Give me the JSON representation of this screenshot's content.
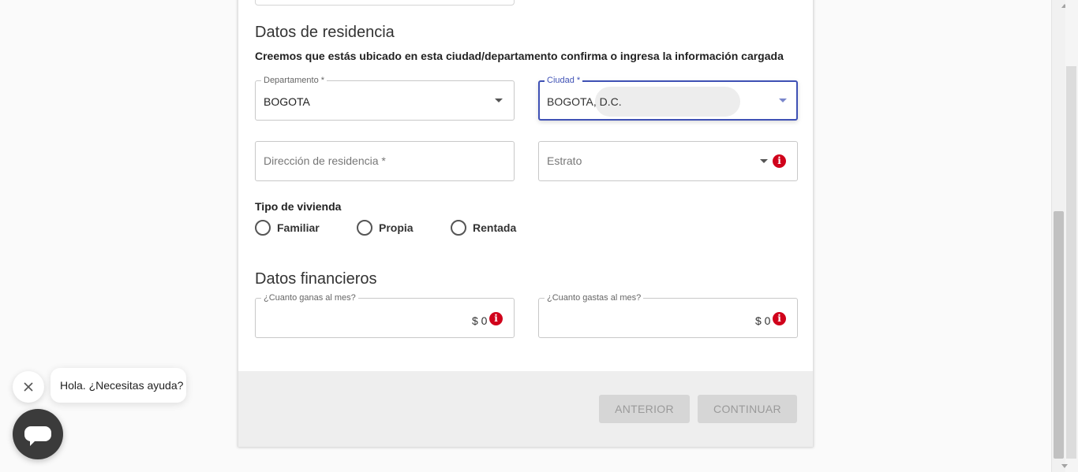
{
  "residence": {
    "title": "Datos de residencia",
    "subtitle": "Creemos que estás ubicado en esta ciudad/departamento confirma o ingresa la información cargada",
    "departamento": {
      "label": "Departamento *",
      "value": "BOGOTA"
    },
    "ciudad": {
      "label": "Ciudad *",
      "value": "BOGOTA, D.C."
    },
    "direccion": {
      "placeholder": "Dirección de residencia *"
    },
    "estrato": {
      "placeholder": "Estrato"
    },
    "housing_type": {
      "label": "Tipo de vivienda",
      "options": [
        "Familiar",
        "Propia",
        "Rentada"
      ]
    }
  },
  "financial": {
    "title": "Datos financieros",
    "income": {
      "label": "¿Cuanto ganas al mes?",
      "value": "$ 0"
    },
    "expenses": {
      "label": "¿Cuanto gastas al mes?",
      "value": "$ 0"
    }
  },
  "footer": {
    "previous_label": "ANTERIOR",
    "continue_label": "CONTINUAR"
  },
  "chat": {
    "greeting": "Hola. ¿Necesitas ayuda?"
  },
  "icons": {
    "info": "info-icon",
    "caret": "chevron-down-icon",
    "close": "close-icon",
    "chat": "chat-icon"
  },
  "colors": {
    "accent": "#3f51b5",
    "info_red": "#d0021b",
    "disabled_button": "#d6d6d6"
  }
}
